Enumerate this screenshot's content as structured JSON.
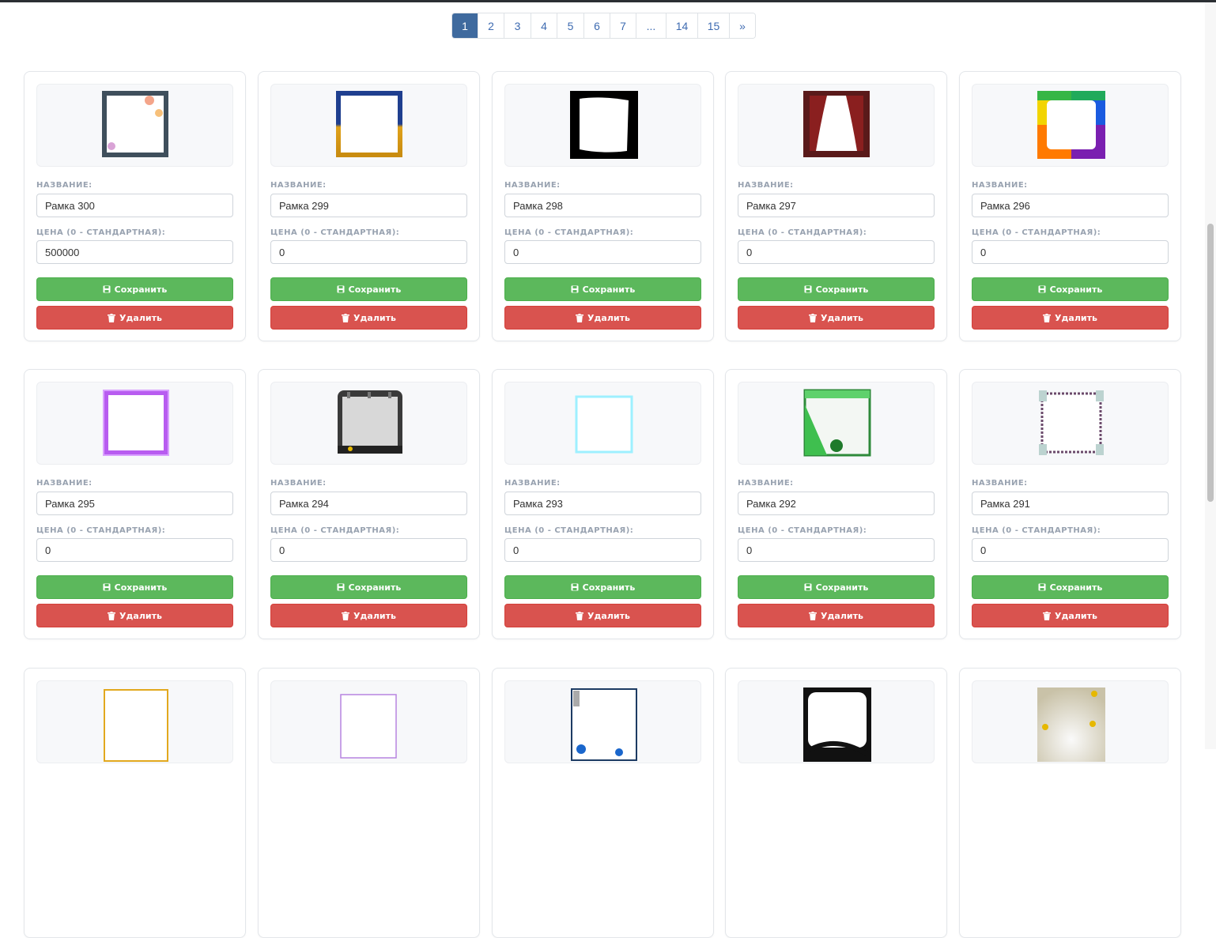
{
  "pagination": {
    "pages": [
      "1",
      "2",
      "3",
      "4",
      "5",
      "6",
      "7",
      "...",
      "14",
      "15",
      "»"
    ],
    "active": "1"
  },
  "labels": {
    "name": "НАЗВАНИЕ:",
    "price": "ЦЕНА (0 - СТАНДАРТНАЯ):",
    "save": "Сохранить",
    "delete": "Удалить"
  },
  "cards": [
    {
      "name": "Рамка 300",
      "price": "500000",
      "thumb": "floral-frame"
    },
    {
      "name": "Рамка 299",
      "price": "0",
      "thumb": "blue-yellow-frame"
    },
    {
      "name": "Рамка 298",
      "price": "0",
      "thumb": "black-frame"
    },
    {
      "name": "Рамка 297",
      "price": "0",
      "thumb": "curtain-frame"
    },
    {
      "name": "Рамка 296",
      "price": "0",
      "thumb": "rainbow-frame"
    },
    {
      "name": "Рамка 295",
      "price": "0",
      "thumb": "purple-glow-frame"
    },
    {
      "name": "Рамка 294",
      "price": "0",
      "thumb": "stage-frame"
    },
    {
      "name": "Рамка 293",
      "price": "0",
      "thumb": "cyan-glow-frame"
    },
    {
      "name": "Рамка 292",
      "price": "0",
      "thumb": "green-frame"
    },
    {
      "name": "Рамка 291",
      "price": "0",
      "thumb": "columns-frame"
    },
    {
      "thumb": "gold-line-frame"
    },
    {
      "thumb": "thin-purple-frame"
    },
    {
      "thumb": "penguin-frame"
    },
    {
      "thumb": "black-ornament-frame"
    },
    {
      "thumb": "coins-frame"
    }
  ],
  "colors": {
    "accent": "#3f6a9e",
    "save": "#5cb85c",
    "delete": "#d9534f"
  }
}
